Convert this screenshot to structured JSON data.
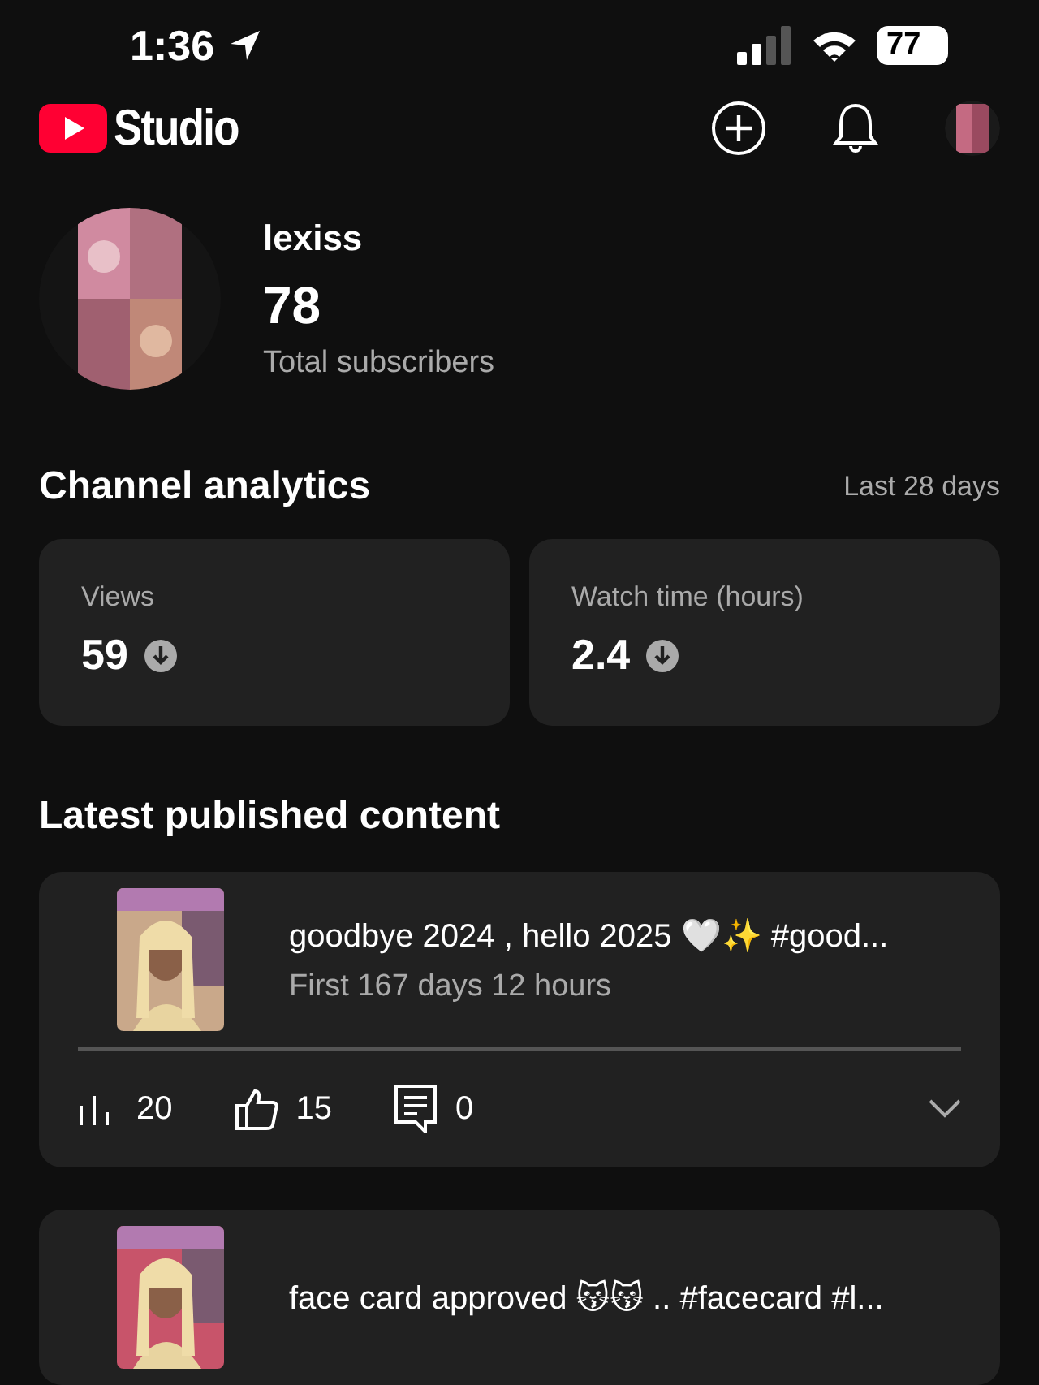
{
  "status_bar": {
    "time": "1:36",
    "battery": "77"
  },
  "header": {
    "title": "Studio"
  },
  "channel": {
    "name": "lexiss",
    "subscribers": "78",
    "subscribers_label": "Total subscribers"
  },
  "analytics": {
    "title": "Channel analytics",
    "period": "Last 28 days",
    "metrics": [
      {
        "label": "Views",
        "value": "59",
        "kind": "decrease"
      },
      {
        "label": "Watch time (hours)",
        "value": "2.4",
        "kind": "decrease"
      }
    ]
  },
  "latest": {
    "title": "Latest published content",
    "items": [
      {
        "title": "goodbye 2024 , hello 2025 🤍✨ #good...",
        "subtitle": "First 167 days 12 hours",
        "views": "20",
        "likes": "15",
        "comments": "0"
      },
      {
        "title": "face card approved 😽😽 .. #facecard #l..."
      }
    ]
  }
}
